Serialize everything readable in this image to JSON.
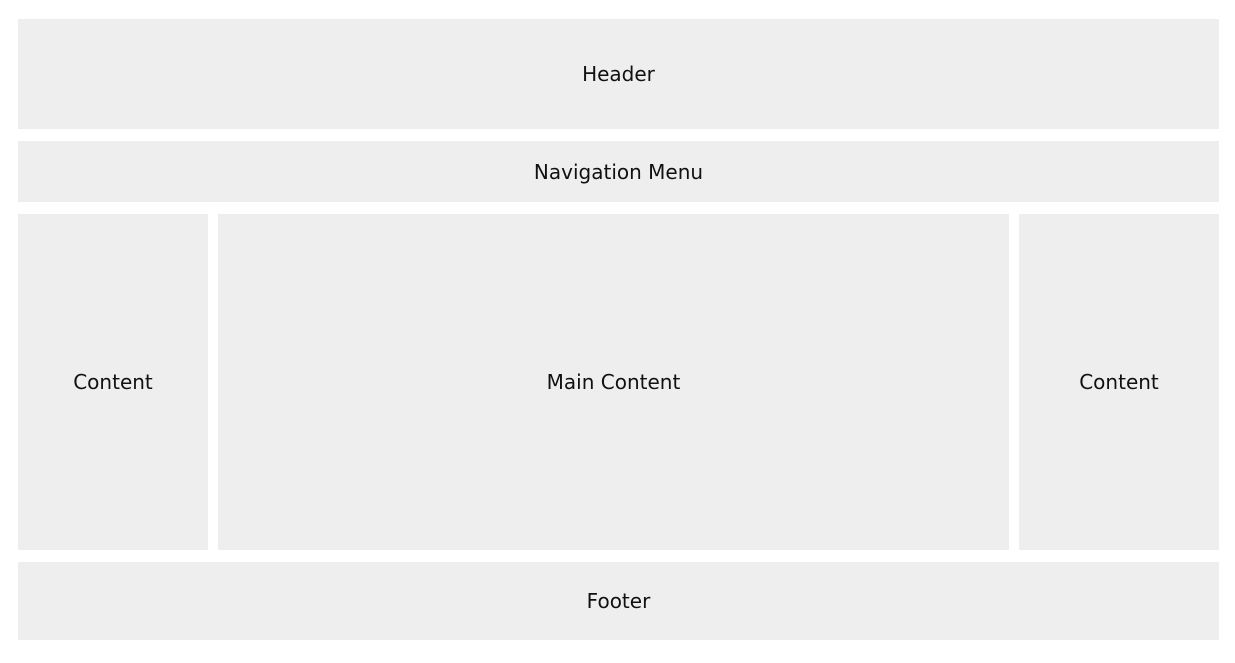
{
  "header": {
    "label": "Header"
  },
  "navigation": {
    "label": "Navigation Menu"
  },
  "left_sidebar": {
    "label": "Content"
  },
  "main": {
    "label": "Main Content"
  },
  "right_sidebar": {
    "label": "Content"
  },
  "footer": {
    "label": "Footer"
  },
  "colors": {
    "panel_background": "#eeeeee",
    "page_background": "#ffffff",
    "text": "#111111"
  }
}
